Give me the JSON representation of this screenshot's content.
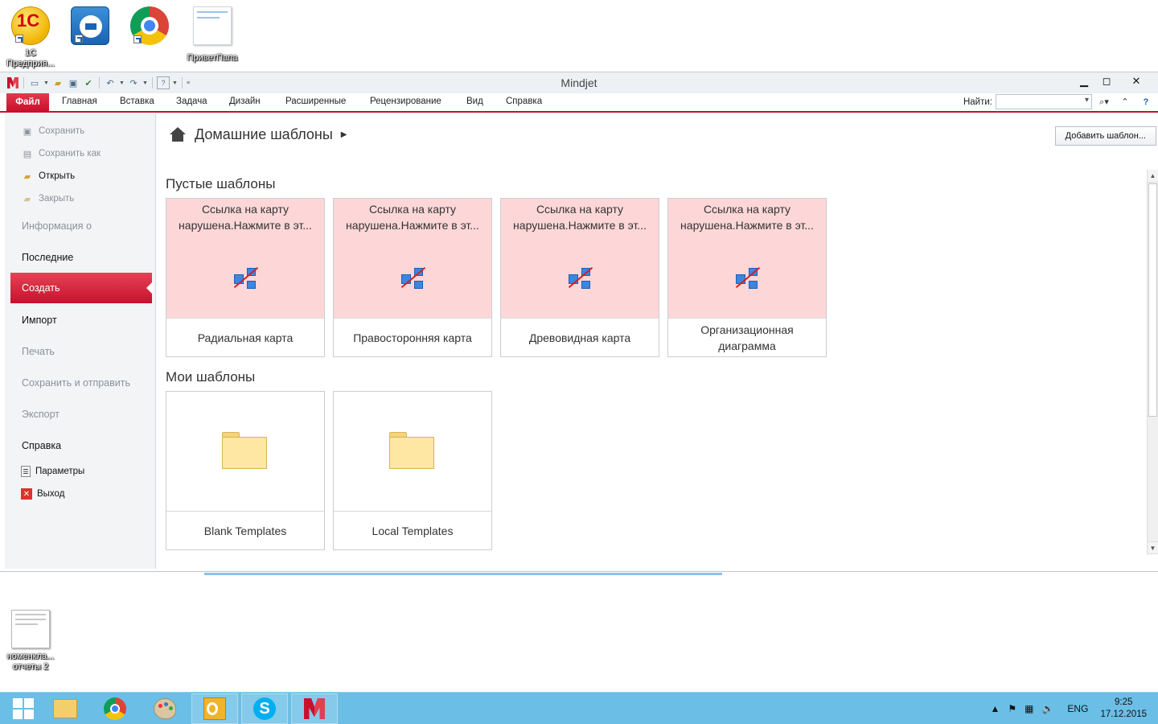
{
  "desktop": {
    "icons": [
      {
        "name": "1С Предприя...",
        "line1": "1С",
        "line2": "Предприя..."
      },
      {
        "name": "TeamViewer",
        "line1": "",
        "line2": ""
      },
      {
        "name": "Google Chrome",
        "line1": "",
        "line2": ""
      },
      {
        "name": "ПриветПапа",
        "line1": "ПриветПапа",
        "line2": ""
      },
      {
        "name": "номенкла... отчеты 2",
        "line1": "номенкла...",
        "line2": "отчеты 2"
      }
    ]
  },
  "window": {
    "title": "Mindjet",
    "tabs": [
      "Файл",
      "Главная",
      "Вставка",
      "Задача",
      "Дизайн",
      "Расширенные",
      "Рецензирование",
      "Вид",
      "Справка"
    ],
    "find_label": "Найти:",
    "find_value": ""
  },
  "backstage": {
    "small_items": [
      {
        "label": "Сохранить",
        "disabled": true
      },
      {
        "label": "Сохранить как",
        "disabled": true
      },
      {
        "label": "Открыть",
        "disabled": false
      },
      {
        "label": "Закрыть",
        "disabled": true
      }
    ],
    "big_items": {
      "info": "Информация о",
      "recent": "Последние",
      "create": "Создать",
      "import": "Импорт",
      "print": "Печать",
      "save_send": "Сохранить и отправить",
      "export": "Экспорт",
      "help": "Справка"
    },
    "bottom_items": [
      {
        "label": "Параметры"
      },
      {
        "label": "Выход"
      }
    ],
    "breadcrumb": "Домашние шаблоны",
    "add_button": "Добавить шаблон...",
    "sections": {
      "blank_title": "Пустые шаблоны",
      "mine_title": "Мои шаблоны"
    },
    "broken_message_line1": "Ссылка на карту",
    "broken_message_line2": "нарушена.Нажмите в эт...",
    "blank_templates": [
      {
        "label": "Радиальная карта"
      },
      {
        "label": "Правосторонняя карта"
      },
      {
        "label": "Древовидная карта"
      },
      {
        "label": "Организационная диаграмма"
      }
    ],
    "my_templates": [
      {
        "label": "Blank Templates"
      },
      {
        "label": "Local Templates"
      }
    ]
  },
  "taskbar": {
    "lang": "ENG",
    "time": "9:25",
    "date": "17.12.2015"
  },
  "colors": {
    "accent": "#c8102e",
    "broken_bg": "#fdd7d8",
    "taskbar": "#6bbfe6"
  }
}
